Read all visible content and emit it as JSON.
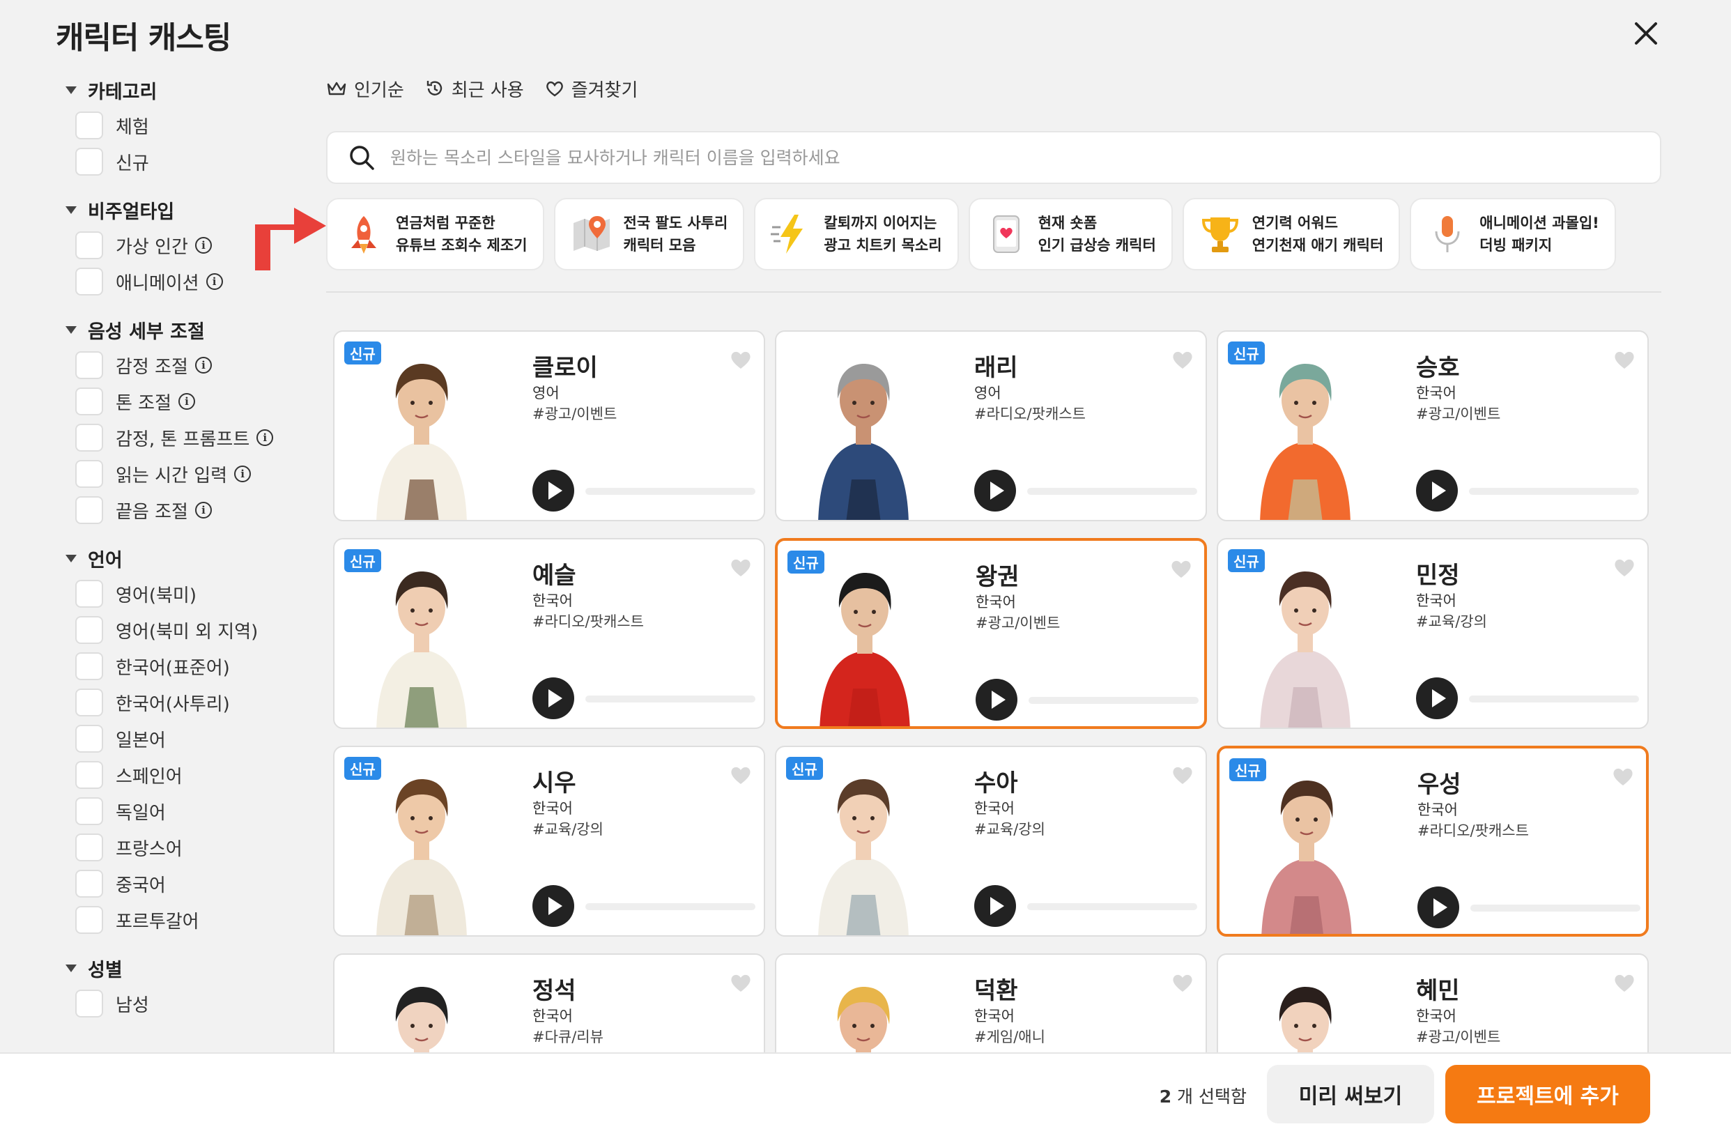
{
  "title": "캐릭터 캐스팅",
  "sidebar": {
    "sections": [
      {
        "label": "카테고리",
        "options": [
          {
            "label": "체험",
            "info": false
          },
          {
            "label": "신규",
            "info": false
          }
        ]
      },
      {
        "label": "비주얼타입",
        "options": [
          {
            "label": "가상 인간",
            "info": true
          },
          {
            "label": "애니메이션",
            "info": true
          }
        ]
      },
      {
        "label": "음성 세부 조절",
        "options": [
          {
            "label": "감정 조절",
            "info": true
          },
          {
            "label": "톤 조절",
            "info": true
          },
          {
            "label": "감정, 톤 프롬프트",
            "info": true
          },
          {
            "label": "읽는 시간 입력",
            "info": true
          },
          {
            "label": "끝음 조절",
            "info": true
          }
        ]
      },
      {
        "label": "언어",
        "options": [
          {
            "label": "영어(북미)",
            "info": false
          },
          {
            "label": "영어(북미 외 지역)",
            "info": false
          },
          {
            "label": "한국어(표준어)",
            "info": false
          },
          {
            "label": "한국어(사투리)",
            "info": false
          },
          {
            "label": "일본어",
            "info": false
          },
          {
            "label": "스페인어",
            "info": false
          },
          {
            "label": "독일어",
            "info": false
          },
          {
            "label": "프랑스어",
            "info": false
          },
          {
            "label": "중국어",
            "info": false
          },
          {
            "label": "포르투갈어",
            "info": false
          }
        ]
      },
      {
        "label": "성별",
        "options": [
          {
            "label": "남성",
            "info": false
          }
        ]
      }
    ]
  },
  "sort": {
    "popular": "인기순",
    "recent": "최근 사용",
    "favorites": "즐겨찾기"
  },
  "search": {
    "placeholder": "원하는 목소리 스타일을 묘사하거나 캐릭터 이름을 입력하세요",
    "value": ""
  },
  "chips": [
    {
      "line1": "연금처럼 꾸준한",
      "line2": "유튜브 조회수 제조기",
      "icon": "rocket-icon"
    },
    {
      "line1": "전국 팔도 사투리",
      "line2": "캐릭터 모음",
      "icon": "map-pin-icon"
    },
    {
      "line1": "칼퇴까지 이어지는",
      "line2": "광고 치트키 목소리",
      "icon": "lightning-icon"
    },
    {
      "line1": "현재 숏폼",
      "line2": "인기 급상승 캐릭터",
      "icon": "phone-heart-icon"
    },
    {
      "line1": "연기력 어워드",
      "line2": "연기천재 애기 캐릭터",
      "icon": "trophy-icon"
    },
    {
      "line1": "애니메이션 과몰입!",
      "line2": "더빙 패키지",
      "icon": "microphone-icon"
    }
  ],
  "badge_label": "신규",
  "cards": [
    {
      "name": "클로이",
      "language": "영어",
      "tag": "#광고/이벤트",
      "badge": true,
      "selected": false,
      "colors": {
        "hair": "#5a3a22",
        "top": "#f4efe4",
        "bottom": "#8a6b55",
        "skin": "#e9c2a0"
      }
    },
    {
      "name": "래리",
      "language": "영어",
      "tag": "#라디오/팟캐스트",
      "badge": false,
      "selected": false,
      "colors": {
        "hair": "#9a9a9a",
        "top": "#2d4a7a",
        "bottom": "#1e2e4a",
        "skin": "#c99273"
      }
    },
    {
      "name": "승호",
      "language": "한국어",
      "tag": "#광고/이벤트",
      "badge": true,
      "selected": false,
      "colors": {
        "hair": "#7aa89b",
        "top": "#f26a2e",
        "bottom": "#c9b48a",
        "skin": "#eac3a3"
      }
    },
    {
      "name": "예슬",
      "language": "한국어",
      "tag": "#라디오/팟캐스트",
      "badge": true,
      "selected": false,
      "colors": {
        "hair": "#3b2a20",
        "top": "#f3efe3",
        "bottom": "#7c8f6a",
        "skin": "#efcdb2"
      }
    },
    {
      "name": "왕권",
      "language": "한국어",
      "tag": "#광고/이벤트",
      "badge": true,
      "selected": true,
      "colors": {
        "hair": "#1b1b1b",
        "top": "#d4251d",
        "bottom": "#c11e17",
        "skin": "#e6c0a0"
      }
    },
    {
      "name": "민정",
      "language": "한국어",
      "tag": "#교육/강의",
      "badge": true,
      "selected": false,
      "colors": {
        "hair": "#4a2f24",
        "top": "#e8d7d9",
        "bottom": "#cfb9bd",
        "skin": "#f0cfb7"
      }
    },
    {
      "name": "시우",
      "language": "한국어",
      "tag": "#교육/강의",
      "badge": true,
      "selected": false,
      "colors": {
        "hair": "#6b4325",
        "top": "#efe9dc",
        "bottom": "#b8a58a",
        "skin": "#eec9a8"
      }
    },
    {
      "name": "수아",
      "language": "한국어",
      "tag": "#교육/강의",
      "badge": true,
      "selected": false,
      "colors": {
        "hair": "#5b3d2a",
        "top": "#f1eee6",
        "bottom": "#a9b5b8",
        "skin": "#f1d0b6"
      }
    },
    {
      "name": "우성",
      "language": "한국어",
      "tag": "#라디오/팟캐스트",
      "badge": true,
      "selected": true,
      "colors": {
        "hair": "#4e3121",
        "top": "#d3898a",
        "bottom": "#b36c70",
        "skin": "#eac3a3"
      }
    },
    {
      "name": "정석",
      "language": "한국어",
      "tag": "#다큐/리뷰",
      "badge": false,
      "selected": false,
      "colors": {
        "hair": "#222222",
        "top": "#f2f2f2",
        "bottom": "#ddd",
        "skin": "#f0d3c0"
      }
    },
    {
      "name": "덕환",
      "language": "한국어",
      "tag": "#게임/애니",
      "badge": false,
      "selected": false,
      "colors": {
        "hair": "#e8b54a",
        "top": "#d9a14a",
        "bottom": "#c58a3c",
        "skin": "#e9b797"
      }
    },
    {
      "name": "혜민",
      "language": "한국어",
      "tag": "#광고/이벤트",
      "badge": false,
      "selected": false,
      "colors": {
        "hair": "#2a1f1c",
        "top": "#dfe9d5",
        "bottom": "#cfdcc4",
        "skin": "#f1d2bd"
      }
    }
  ],
  "footer": {
    "count": "2",
    "count_suffix": "개 선택함",
    "preview_label": "미리 써보기",
    "add_label": "프로젝트에 추가"
  },
  "colors": {
    "accent": "#f57a12",
    "badge": "#2b8ae8",
    "selected_border": "#f07b1e",
    "arrow": "#e8403a"
  }
}
